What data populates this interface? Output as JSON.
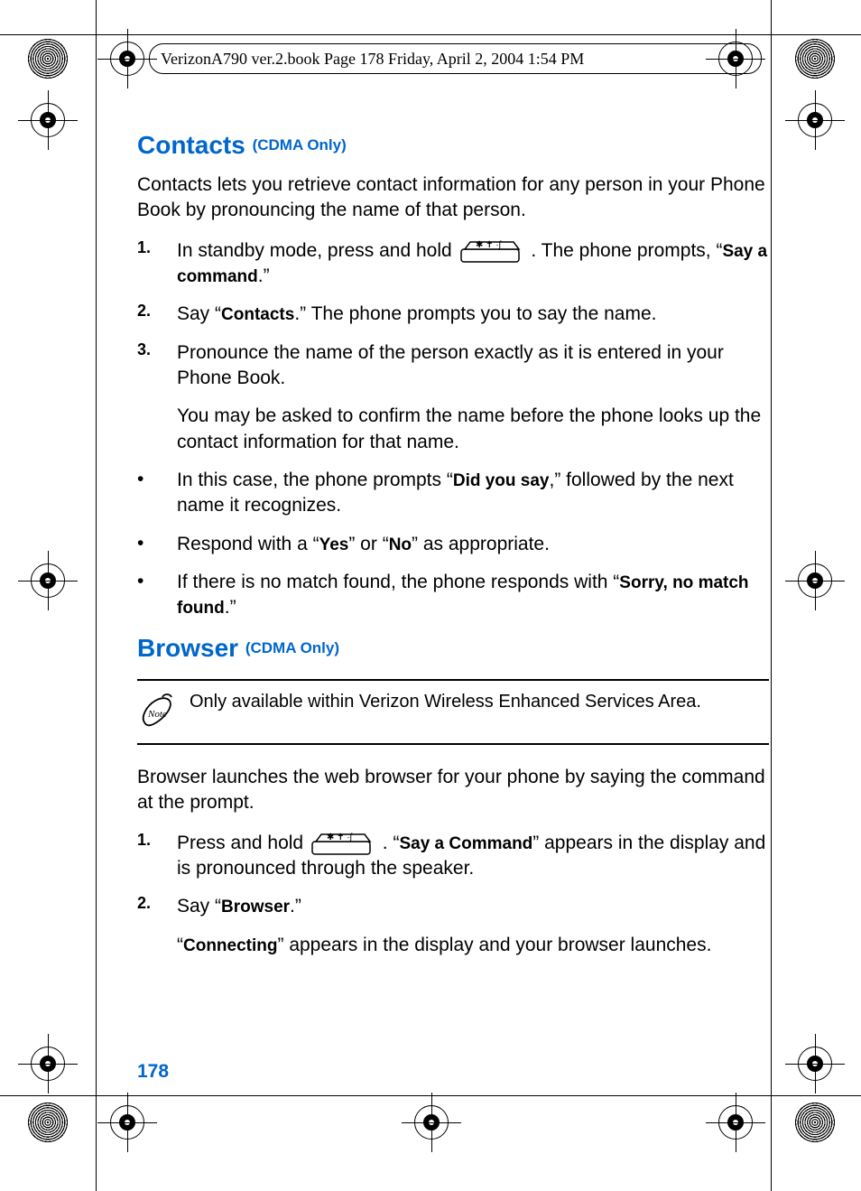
{
  "header": "VerizonA790 ver.2.book  Page 178  Friday, April 2, 2004  1:54 PM",
  "section1": {
    "title": "Contacts",
    "tag": "(CDMA Only)",
    "intro": "Contacts lets you retrieve contact information for any person in your Phone Book by pronouncing the name of that person.",
    "steps": [
      {
        "num": "1.",
        "pre": "In standby mode, press and hold ",
        "post": " . The phone prompts, “",
        "bold": "Say a command",
        "tail": ".”"
      },
      {
        "num": "2.",
        "pre": "Say “",
        "bold": "Contacts",
        "post": ".” The phone prompts you to say the name."
      },
      {
        "num": "3.",
        "line1": "Pronounce the name of the person exactly as it is entered in your Phone Book.",
        "line2": "You may be asked to confirm the name before the phone looks up the contact information for that name."
      }
    ],
    "bullets": [
      {
        "pre": "In this case, the phone prompts “",
        "bold": "Did you say",
        "post": ",” followed by the next name it recognizes."
      },
      {
        "pre": "Respond with a “",
        "bold1": "Yes",
        "mid": "” or “",
        "bold2": "No",
        "post": "” as appropriate."
      },
      {
        "pre": "If there is no match found, the phone responds with “",
        "bold": "Sorry, no match found",
        "post": ".”"
      }
    ]
  },
  "section2": {
    "title": "Browser",
    "tag": "(CDMA Only)",
    "note": "Only available within Verizon Wireless Enhanced Services Area.",
    "intro": "Browser launches the web browser for your phone by saying the command at the prompt.",
    "steps": [
      {
        "num": "1.",
        "pre": "Press and hold ",
        "post": " . “",
        "bold": "Say a Command",
        "tail": "” appears in the display and is pronounced through the speaker."
      },
      {
        "num": "2.",
        "pre": "Say “",
        "bold": "Browser",
        "post": ".”",
        "sub_pre": "“",
        "sub_bold": "Connecting",
        "sub_post": "” appears in the display and your browser launches."
      }
    ]
  },
  "page_number": "178"
}
